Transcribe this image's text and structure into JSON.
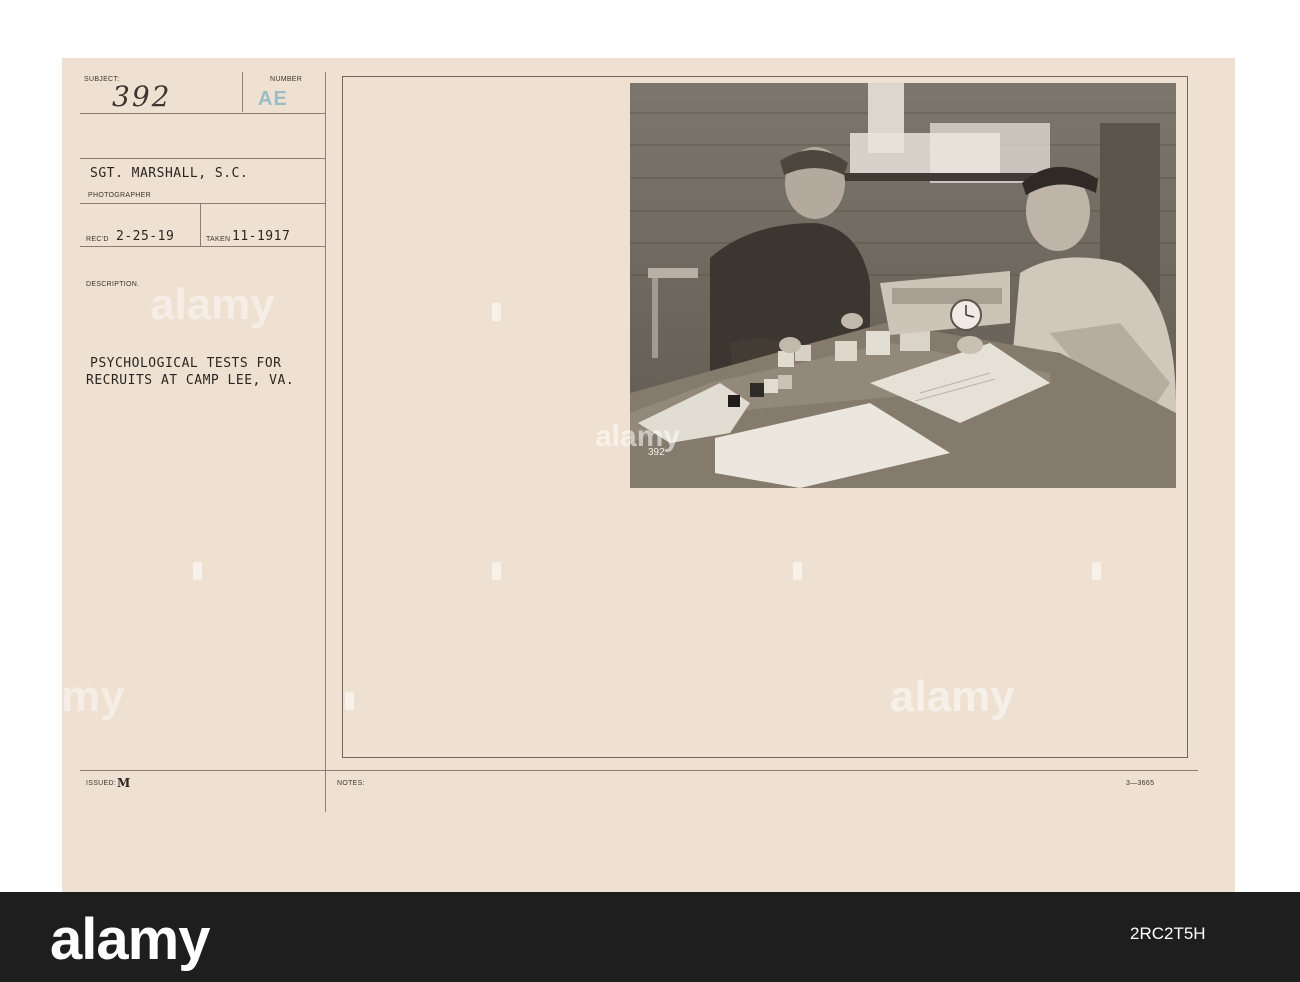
{
  "card": {
    "subject_label": "SUBJECT:",
    "subject_value": "392",
    "number_label": "NUMBER",
    "number_value": "AE",
    "photographer_value": "SGT. MARSHALL, S.C.",
    "photographer_label": "PHOTOGRAPHER",
    "recd_label": "REC'D",
    "recd_value": "2-25-19",
    "taken_label": "TAKEN",
    "taken_value": "11-1917",
    "description_label": "DESCRIPTION.",
    "description_line1": "PSYCHOLOGICAL TESTS FOR",
    "description_line2": "RECRUITS AT CAMP LEE, VA.",
    "issued_label": "ISSUED:",
    "issued_value": "M",
    "notes_label": "NOTES:",
    "form_code": "3—3665"
  },
  "photo": {
    "negative_number": "392"
  },
  "watermark": {
    "text": "alamy"
  },
  "footer": {
    "logo": "alamy",
    "stock_id": "2RC2T5H"
  }
}
